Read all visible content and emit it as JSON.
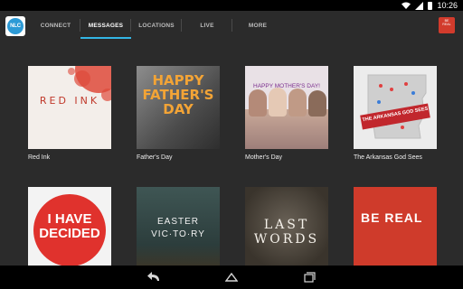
{
  "status": {
    "time": "10:26"
  },
  "app": {
    "logo_text": "NLC"
  },
  "tabs": [
    {
      "label": "CONNECT"
    },
    {
      "label": "MESSAGES"
    },
    {
      "label": "LOCATIONS"
    },
    {
      "label": "LIVE"
    },
    {
      "label": "MORE"
    }
  ],
  "brand_box": {
    "text": "BE REAL"
  },
  "series": [
    {
      "title": "Red Ink",
      "cover_text": "RED INK"
    },
    {
      "title": "Father's Day",
      "cover_text": "HAPPY FATHER'S DAY"
    },
    {
      "title": "Mother's Day",
      "cover_text": "HAPPY MOTHER'S DAY!"
    },
    {
      "title": "The Arkansas God Sees",
      "cover_text": "THE ARKANSAS GOD SEES"
    },
    {
      "title": "",
      "cover_text": "I HAVE DECIDED"
    },
    {
      "title": "",
      "cover_text": "EASTER VIC·TO·RY"
    },
    {
      "title": "",
      "cover_text": "LAST WORDS"
    },
    {
      "title": "",
      "cover_text": "BE REAL"
    }
  ],
  "colors": {
    "accent": "#33b5e5",
    "appbar": "#2b2b2b"
  }
}
